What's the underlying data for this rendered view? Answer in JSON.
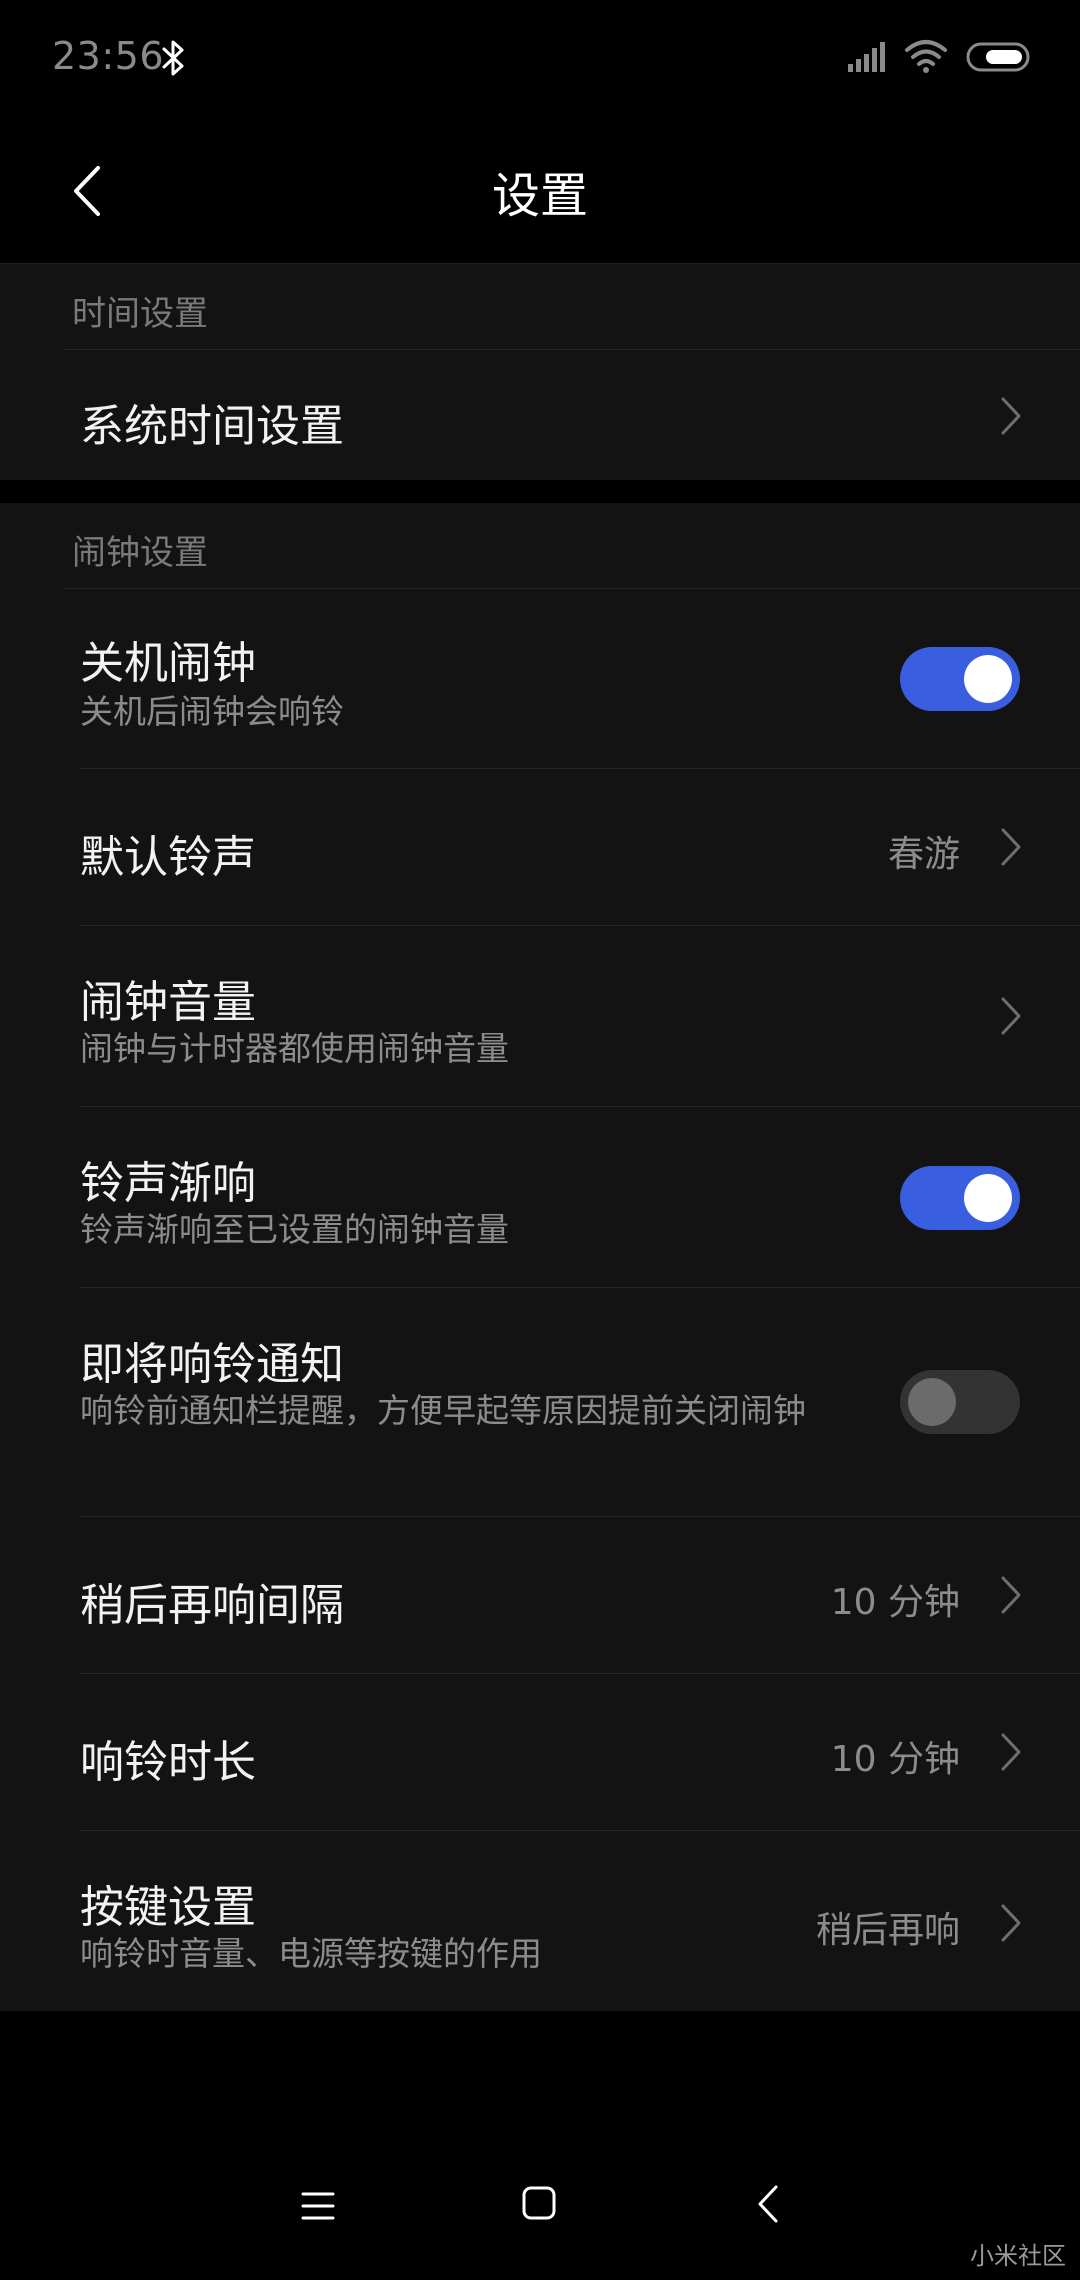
{
  "status_bar": {
    "time": "23:56",
    "icons": [
      "bluetooth-icon",
      "signal-icon",
      "wifi-icon",
      "battery-icon"
    ]
  },
  "header": {
    "title": "设置"
  },
  "sections": {
    "time": {
      "header": "时间设置",
      "rows": [
        {
          "title": "系统时间设置"
        }
      ]
    },
    "alarm": {
      "header": "闹钟设置",
      "rows": [
        {
          "title": "关机闹钟",
          "subtitle": "关机后闹钟会响铃",
          "toggle": true
        },
        {
          "title": "默认铃声",
          "value": "春游"
        },
        {
          "title": "闹钟音量",
          "subtitle": "闹钟与计时器都使用闹钟音量"
        },
        {
          "title": "铃声渐响",
          "subtitle": "铃声渐响至已设置的闹钟音量",
          "toggle": true
        },
        {
          "title": "即将响铃通知",
          "subtitle": "响铃前通知栏提醒，方便早起等原因提前关闭闹钟",
          "toggle": false
        },
        {
          "title": "稍后再响间隔",
          "value": "10 分钟"
        },
        {
          "title": "响铃时长",
          "value": "10 分钟"
        },
        {
          "title": "按键设置",
          "subtitle": "响铃时音量、电源等按键的作用",
          "value": "稍后再响"
        }
      ]
    }
  },
  "colors": {
    "accent": "#3a5ee0",
    "background": "#000000",
    "card": "#131313"
  },
  "watermark": "小米社区"
}
